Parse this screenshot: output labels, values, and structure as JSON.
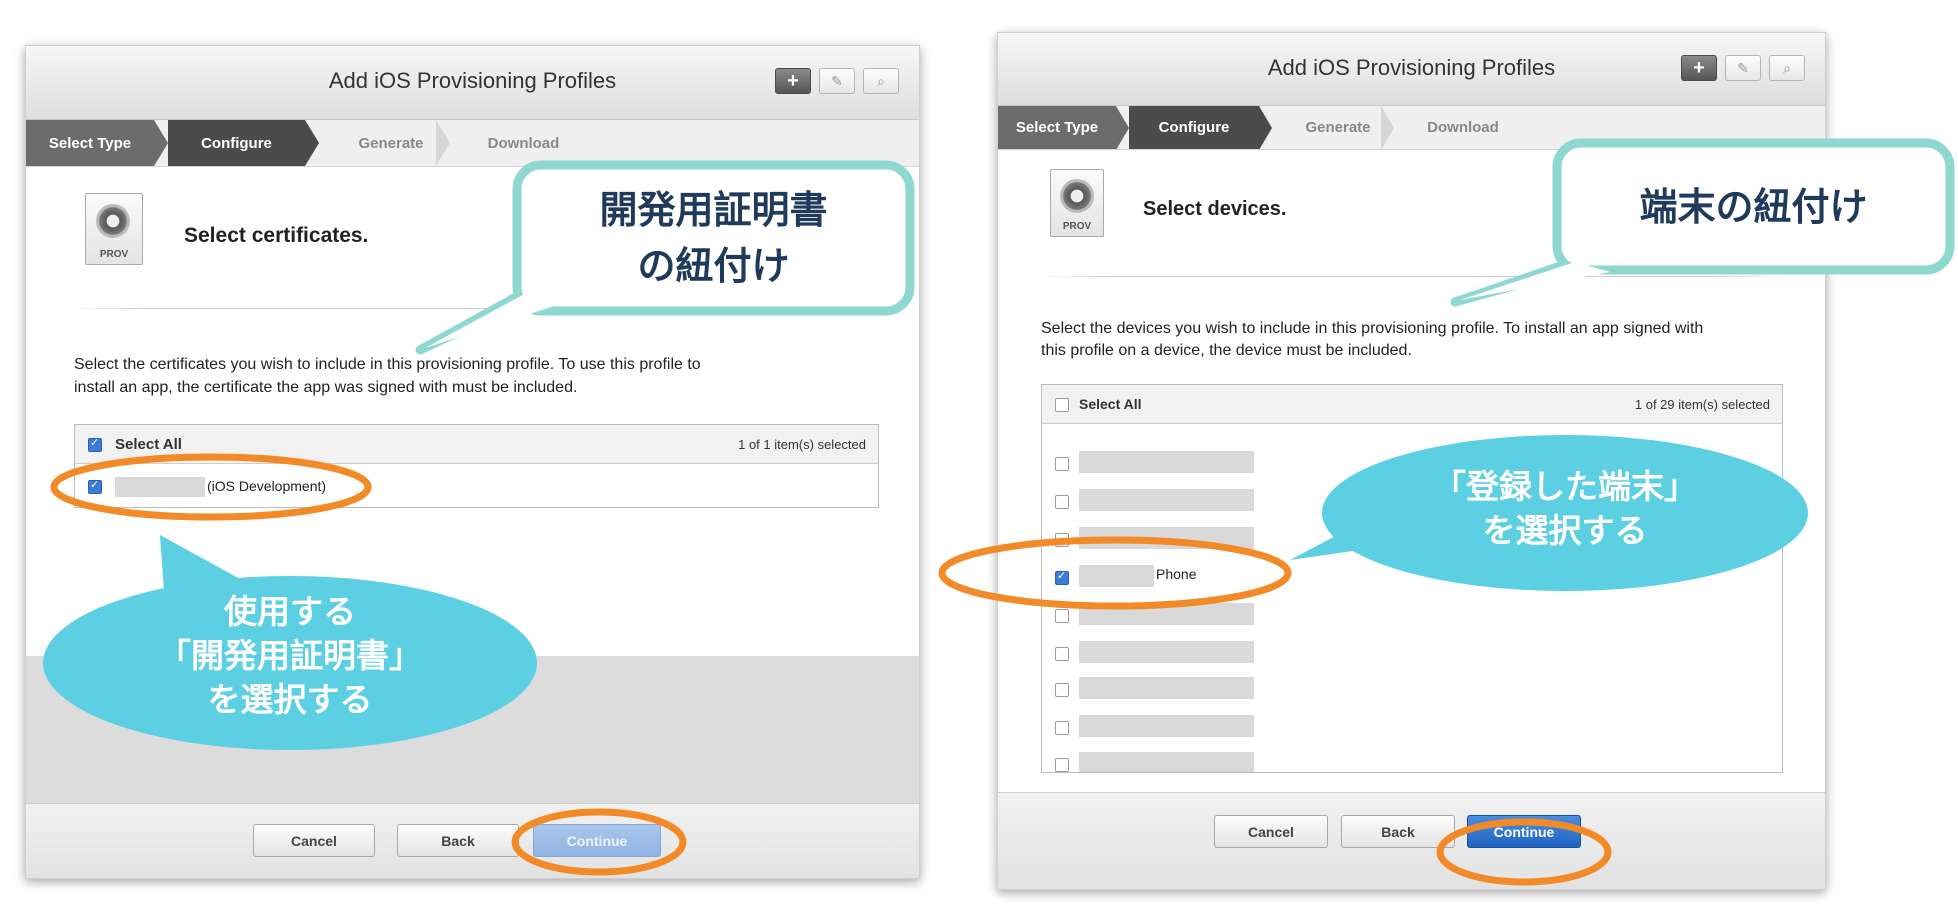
{
  "left_dialog": {
    "title": "Add iOS Provisioning Profiles",
    "header_buttons": [
      "plus-icon",
      "edit-icon",
      "search-icon"
    ],
    "steps": [
      "Select Type",
      "Configure",
      "Generate",
      "Download"
    ],
    "icon_label": "PROV",
    "heading": "Select certificates.",
    "description_line1": "Select the certificates you wish to include in this provisioning profile. To use this profile to",
    "description_line2": "install an app, the certificate the app was signed with must be included.",
    "select_all_label": "Select All",
    "selection_count": "1   of 1 item(s) selected",
    "items": [
      {
        "text": "(iOS Development)",
        "checked": true
      }
    ],
    "buttons": {
      "cancel": "Cancel",
      "back": "Back",
      "continue": "Continue"
    }
  },
  "right_dialog": {
    "title": "Add iOS Provisioning Profiles",
    "header_buttons": [
      "plus-icon",
      "edit-icon",
      "search-icon"
    ],
    "steps": [
      "Select Type",
      "Configure",
      "Generate",
      "Download"
    ],
    "icon_label": "PROV",
    "heading": "Select devices.",
    "description_line1": "Select the devices you wish to include in this provisioning profile. To install an app signed with",
    "description_line2": "this profile on a device, the device must be included.",
    "select_all_label": "Select All",
    "selection_count": "1   of 29 item(s) selected",
    "items": [
      {
        "text": "",
        "checked": false
      },
      {
        "text": "",
        "checked": false
      },
      {
        "text": "",
        "checked": false
      },
      {
        "text": "Phone",
        "checked": true
      },
      {
        "text": "",
        "checked": false
      },
      {
        "text": "",
        "checked": false
      },
      {
        "text": "",
        "checked": false
      },
      {
        "text": "",
        "checked": false
      },
      {
        "text": "",
        "checked": false
      }
    ],
    "buttons": {
      "cancel": "Cancel",
      "back": "Back",
      "continue": "Continue"
    }
  },
  "callouts": {
    "left_rect": {
      "line1": "開発用証明書",
      "line2": "の紐付け"
    },
    "left_oval": {
      "line1": "使用する",
      "line2": "「開発用証明書」",
      "line3": "を選択する"
    },
    "right_rect": {
      "line1": "端末の紐付け"
    },
    "right_oval": {
      "line1": "「登録した端末」",
      "line2": "を選択する"
    }
  },
  "colors": {
    "teal_border": "#8fd8d2",
    "cyan_bubble": "#5dcfe3",
    "orange_highlight": "#f28a28",
    "primary_button": "#2a6fce"
  }
}
